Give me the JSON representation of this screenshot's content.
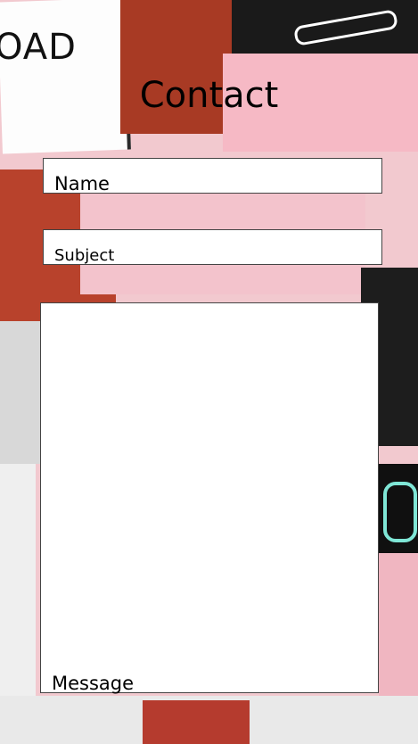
{
  "contact": {
    "title": "Contact",
    "name_label": "Name",
    "subject_label": "Subject",
    "message_label": "Message"
  },
  "background": {
    "sign_text": "OAD",
    "colors": {
      "accent_red": "#a83a24",
      "pink": "#f2c9cf",
      "teal": "#7fe6d6"
    }
  }
}
